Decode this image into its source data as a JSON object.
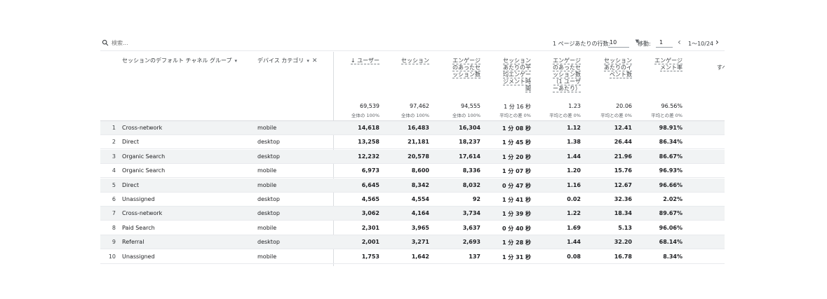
{
  "toolbar": {
    "search_placeholder": "検索...",
    "rows_per_page_label": "1 ページあたりの行数:",
    "rows_per_page_value": "10",
    "goto_label": "移動:",
    "goto_value": "1",
    "pager_text": "1～10/24"
  },
  "dimensions": {
    "channel_group": "セッションのデフォルト チャネル グループ",
    "device_category": "デバイス カテゴリ"
  },
  "metrics": [
    {
      "label": "↓ ユーザー",
      "total": "69,539",
      "sub": "全体の 100%"
    },
    {
      "label": "セッション",
      "total": "97,462",
      "sub": "全体の 100%"
    },
    {
      "label": "エンゲージ\nのあったセ\nッション数",
      "total": "94,555",
      "sub": "全体の 100%"
    },
    {
      "label": "セッション\nあたりの平\n均エンゲー\nジメント時\n間",
      "total": "1 分 16 秒",
      "sub": "平均との差 0%"
    },
    {
      "label": "エンゲージ\nのあったセ\nッション数\n（1 ユーザ\nーあたり）",
      "total": "1.23",
      "sub": "平均との差 0%"
    },
    {
      "label": "セッション\nあたりのイ\nベント数",
      "total": "20.06",
      "sub": "平均との差 0%"
    },
    {
      "label": "エンゲージ\nメント率",
      "total": "96.56%",
      "sub": "平均との差 0%"
    }
  ],
  "cutoff_header": "イ\nすべて",
  "rows": [
    {
      "idx": "1",
      "channel": "Cross-network",
      "device": "mobile",
      "values": [
        "14,618",
        "16,483",
        "16,304",
        "1 分 08 秒",
        "1.12",
        "12.41",
        "98.91%"
      ]
    },
    {
      "idx": "2",
      "channel": "Direct",
      "device": "desktop",
      "values": [
        "13,258",
        "21,181",
        "18,237",
        "1 分 45 秒",
        "1.38",
        "26.44",
        "86.34%"
      ]
    },
    {
      "idx": "3",
      "channel": "Organic Search",
      "device": "desktop",
      "values": [
        "12,232",
        "20,578",
        "17,614",
        "1 分 20 秒",
        "1.44",
        "21.96",
        "86.67%"
      ]
    },
    {
      "idx": "4",
      "channel": "Organic Search",
      "device": "mobile",
      "values": [
        "6,973",
        "8,600",
        "8,336",
        "1 分 07 秒",
        "1.20",
        "15.76",
        "96.93%"
      ]
    },
    {
      "idx": "5",
      "channel": "Direct",
      "device": "mobile",
      "values": [
        "6,645",
        "8,342",
        "8,032",
        "0 分 47 秒",
        "1.16",
        "12.67",
        "96.66%"
      ]
    },
    {
      "idx": "6",
      "channel": "Unassigned",
      "device": "desktop",
      "values": [
        "4,565",
        "4,554",
        "92",
        "1 分 41 秒",
        "0.02",
        "32.36",
        "2.02%"
      ]
    },
    {
      "idx": "7",
      "channel": "Cross-network",
      "device": "desktop",
      "values": [
        "3,062",
        "4,164",
        "3,734",
        "1 分 39 秒",
        "1.22",
        "18.34",
        "89.67%"
      ]
    },
    {
      "idx": "8",
      "channel": "Paid Search",
      "device": "mobile",
      "values": [
        "2,301",
        "3,965",
        "3,637",
        "0 分 40 秒",
        "1.69",
        "5.13",
        "96.06%"
      ]
    },
    {
      "idx": "9",
      "channel": "Referral",
      "device": "desktop",
      "values": [
        "2,001",
        "3,271",
        "2,693",
        "1 分 28 秒",
        "1.44",
        "32.20",
        "68.14%"
      ]
    },
    {
      "idx": "10",
      "channel": "Unassigned",
      "device": "mobile",
      "values": [
        "1,753",
        "1,642",
        "137",
        "1 分 31 秒",
        "0.08",
        "16.78",
        "8.34%"
      ]
    }
  ]
}
